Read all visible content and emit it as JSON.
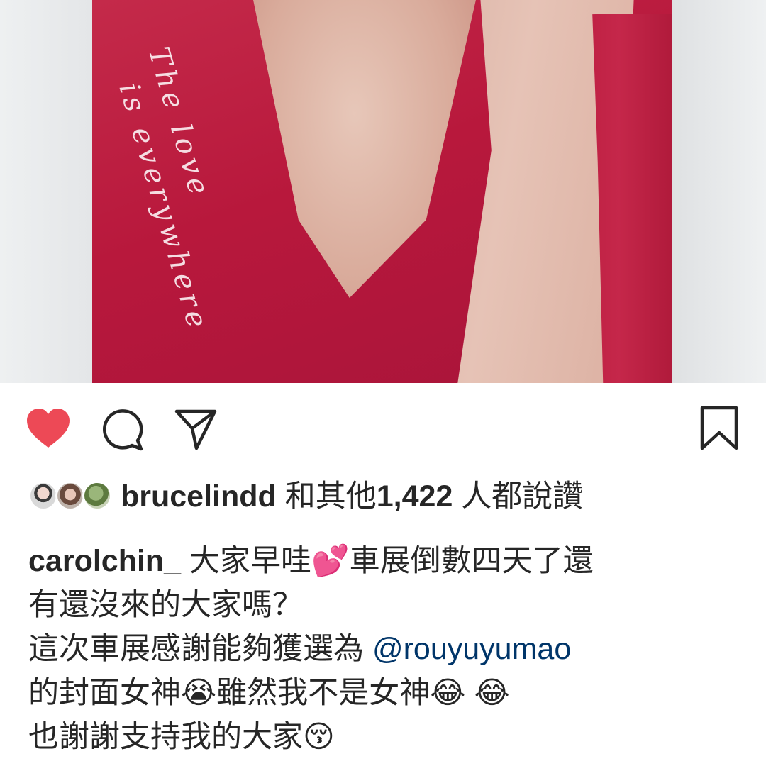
{
  "post": {
    "photo_overlay_text": "The love\n  is everywhere",
    "liked": true
  },
  "actions": {
    "like_icon": "heart-filled-icon",
    "comment_icon": "comment-bubble-icon",
    "share_icon": "paper-plane-icon",
    "save_icon": "bookmark-icon",
    "like_color": "#ed4956"
  },
  "likes": {
    "first_liker": "brucelindd",
    "text_before_count": "和其他",
    "count": "1,422",
    "text_after_count": "人都說讚"
  },
  "caption": {
    "username": "carolchin_",
    "line1_text": "大家早哇",
    "emoji_hearts": "💕",
    "line1_rest": "車展倒數四天了還",
    "line2": "有還沒來的大家嗎？",
    "line3_text": "這次車展感謝能夠獲選為 ",
    "mention": "@rouyuyumao",
    "line4_text": "的封面女神",
    "emoji_cry": "😭",
    "line4_rest": "雖然我不是女神",
    "emoji_laugh": "😂",
    "emoji_laugh2": "😂",
    "line5_text": "也謝謝支持我的大家",
    "emoji_kiss": "😚"
  }
}
